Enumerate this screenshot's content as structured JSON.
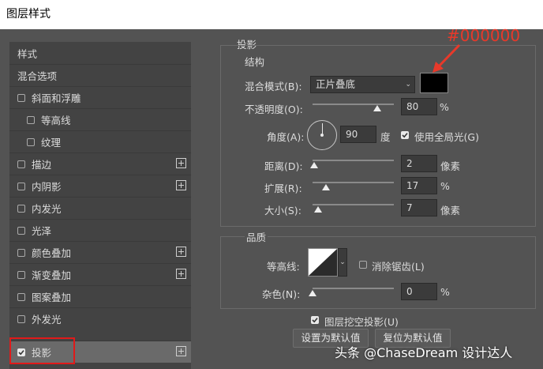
{
  "window": {
    "title": "图层样式"
  },
  "left_panel": {
    "header": "样式",
    "blend_options": "混合选项",
    "items": [
      {
        "label": "斜面和浮雕",
        "checked": false,
        "plus": false
      },
      {
        "label": "等高线",
        "checked": false,
        "plus": false
      },
      {
        "label": "纹理",
        "checked": false,
        "plus": false
      },
      {
        "label": "描边",
        "checked": false,
        "plus": true
      },
      {
        "label": "内阴影",
        "checked": false,
        "plus": true
      },
      {
        "label": "内发光",
        "checked": false,
        "plus": false
      },
      {
        "label": "光泽",
        "checked": false,
        "plus": false
      },
      {
        "label": "颜色叠加",
        "checked": false,
        "plus": true
      },
      {
        "label": "渐变叠加",
        "checked": false,
        "plus": true
      },
      {
        "label": "图案叠加",
        "checked": false,
        "plus": false
      },
      {
        "label": "外发光",
        "checked": false,
        "plus": false
      },
      {
        "label": "投影",
        "checked": true,
        "plus": true
      }
    ]
  },
  "drop_shadow": {
    "title": "投影",
    "structure": {
      "title": "结构",
      "blend_mode_label": "混合模式(B):",
      "blend_mode_value": "正片叠底",
      "color": "#000000",
      "opacity_label": "不透明度(O):",
      "opacity_value": "80",
      "opacity_unit": "%",
      "opacity_level": 0.8,
      "angle_label": "角度(A):",
      "angle_value": "90",
      "angle_unit": "度",
      "global_light_label": "使用全局光(G)",
      "global_light_checked": true,
      "distance_label": "距离(D):",
      "distance_value": "2",
      "distance_unit": "像素",
      "spread_label": "扩展(R):",
      "spread_value": "17",
      "spread_unit": "%",
      "size_label": "大小(S):",
      "size_value": "7",
      "size_unit": "像素"
    },
    "quality": {
      "title": "品质",
      "contour_label": "等高线:",
      "anti_alias_label": "消除锯齿(L)",
      "anti_alias_checked": false,
      "noise_label": "杂色(N):",
      "noise_value": "0",
      "noise_unit": "%"
    },
    "knockout_label": "图层挖空投影(U)",
    "knockout_checked": true,
    "set_default_button": "设置为默认值",
    "reset_default_button": "复位为默认值"
  },
  "annotation": {
    "text": "#000000",
    "color": "#e8392a"
  },
  "watermark": "头条 @ChaseDream 设计达人"
}
